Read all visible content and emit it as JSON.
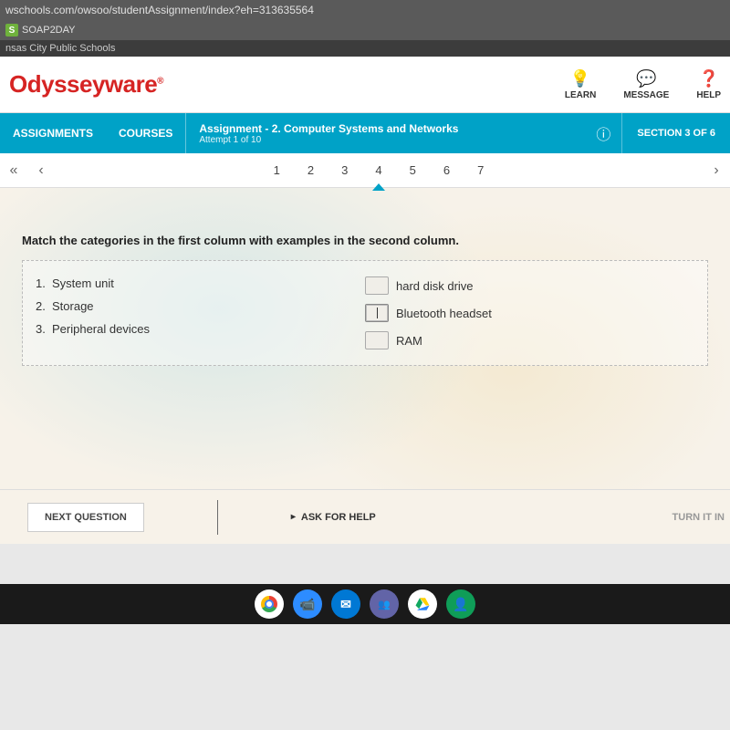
{
  "browser": {
    "url": "wschools.com/owsoo/studentAssignment/index?eh=313635564",
    "bookmark": {
      "icon_letter": "S",
      "label": "SOAP2DAY"
    },
    "tab_title": "nsas City Public Schools"
  },
  "header": {
    "logo": "Odysseyware",
    "actions": {
      "learn": "LEARN",
      "message": "MESSAGE",
      "help": "HELP"
    }
  },
  "bluebar": {
    "assignments": "ASSIGNMENTS",
    "courses": "COURSES",
    "assignment_label": "Assignment",
    "assignment_title": " - 2. Computer Systems and Networks",
    "attempt": "Attempt 1 of 10",
    "section": "SECTION 3 OF 6"
  },
  "pager": {
    "items": [
      "1",
      "2",
      "3",
      "4",
      "5",
      "6",
      "7"
    ],
    "active_index": 3
  },
  "question": {
    "prompt": "Match the categories in the first column with examples in the second column.",
    "left": [
      {
        "n": "1.",
        "text": "System unit"
      },
      {
        "n": "2.",
        "text": "Storage"
      },
      {
        "n": "3.",
        "text": "Peripheral devices"
      }
    ],
    "right": [
      {
        "text": "hard disk drive",
        "focused": false
      },
      {
        "text": "Bluetooth headset",
        "focused": true
      },
      {
        "text": "RAM",
        "focused": false
      }
    ]
  },
  "footer": {
    "next": "NEXT QUESTION",
    "ask": "ASK FOR HELP",
    "turn_in": "TURN IT IN"
  }
}
